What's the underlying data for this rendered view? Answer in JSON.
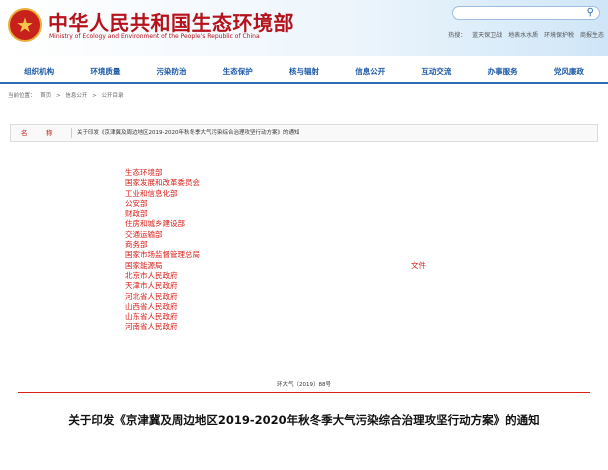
{
  "header": {
    "title": "中华人民共和国生态环境部",
    "subtitle": "Ministry of Ecology and Environment of the People's Republic of China",
    "emblem_icon": "national-emblem-icon",
    "search_icon": "search-icon",
    "quick_links_label": "热搜：",
    "quick_links": [
      "蓝天保卫战",
      "地表水水质",
      "环境保护税",
      "商报生态"
    ]
  },
  "nav": {
    "items": [
      "组织机构",
      "环境质量",
      "污染防治",
      "生态保护",
      "核与辐射",
      "信息公开",
      "互动交流",
      "办事服务",
      "党风廉政"
    ]
  },
  "breadcrumb": {
    "label": "当前位置：",
    "items": [
      "首页",
      ">",
      "信息公开",
      ">",
      "公开目录"
    ]
  },
  "name_row": {
    "label": "名　称",
    "value": "关于印发《京津冀及周边地区2019-2020年秋冬季大气污染综合治理攻坚行动方案》的通知"
  },
  "recipients": [
    "生态环境部",
    "国家发展和改革委员会",
    "工业和信息化部",
    "公安部",
    "财政部",
    "住房和城乡建设部",
    "交通运输部",
    "商务部",
    "国家市场监督管理总局",
    "国家能源局",
    "北京市人民政府",
    "天津市人民政府",
    "河北省人民政府",
    "山西省人民政府",
    "山东省人民政府",
    "河南省人民政府"
  ],
  "doc_type": "文件",
  "doc_number": "环大气〔2019〕88号",
  "doc_title": "关于印发《京津冀及周边地区2019-2020年秋冬季大气污染综合治理攻坚行动方案》的通知",
  "colors": {
    "brand_red": "#b5121b",
    "nav_blue": "#1d5aa8",
    "recipient_red": "#d8201a"
  }
}
